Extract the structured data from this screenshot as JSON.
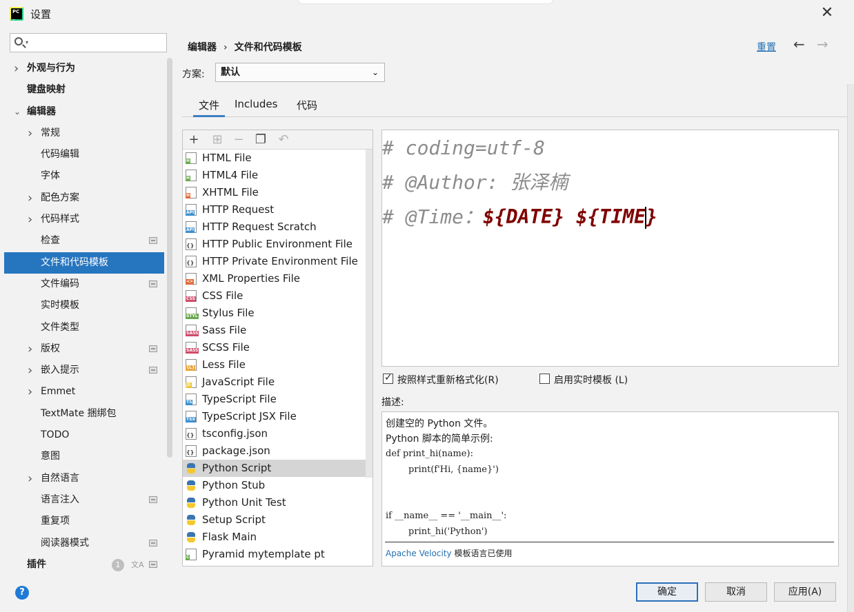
{
  "window": {
    "title": "设置"
  },
  "sidebar": {
    "search_placeholder": "",
    "items": [
      {
        "label": "外观与行为",
        "level": 0,
        "expand": "collapsed",
        "bold": true
      },
      {
        "label": "键盘映射",
        "level": 0,
        "expand": "none",
        "bold": true
      },
      {
        "label": "编辑器",
        "level": 0,
        "expand": "expanded",
        "bold": true
      },
      {
        "label": "常规",
        "level": 1,
        "expand": "collapsed"
      },
      {
        "label": "代码编辑",
        "level": 1,
        "expand": "none"
      },
      {
        "label": "字体",
        "level": 1,
        "expand": "none"
      },
      {
        "label": "配色方案",
        "level": 1,
        "expand": "collapsed"
      },
      {
        "label": "代码样式",
        "level": 1,
        "expand": "collapsed"
      },
      {
        "label": "检查",
        "level": 1,
        "expand": "none",
        "pin": true
      },
      {
        "label": "文件和代码模板",
        "level": 1,
        "expand": "none",
        "selected": true
      },
      {
        "label": "文件编码",
        "level": 1,
        "expand": "none",
        "pin": true
      },
      {
        "label": "实时模板",
        "level": 1,
        "expand": "none"
      },
      {
        "label": "文件类型",
        "level": 1,
        "expand": "none"
      },
      {
        "label": "版权",
        "level": 1,
        "expand": "collapsed",
        "pin": true
      },
      {
        "label": "嵌入提示",
        "level": 1,
        "expand": "collapsed",
        "pin": true
      },
      {
        "label": "Emmet",
        "level": 1,
        "expand": "collapsed"
      },
      {
        "label": "TextMate 捆绑包",
        "level": 1,
        "expand": "none"
      },
      {
        "label": "TODO",
        "level": 1,
        "expand": "none"
      },
      {
        "label": "意图",
        "level": 1,
        "expand": "none"
      },
      {
        "label": "自然语言",
        "level": 1,
        "expand": "collapsed"
      },
      {
        "label": "语言注入",
        "level": 1,
        "expand": "none",
        "pin": true
      },
      {
        "label": "重复项",
        "level": 1,
        "expand": "none"
      },
      {
        "label": "阅读器模式",
        "level": 1,
        "expand": "none",
        "pin": true
      },
      {
        "label": "插件",
        "level": 0,
        "expand": "none",
        "bold": true,
        "badge": "1",
        "translate": true,
        "pin": true
      }
    ]
  },
  "header": {
    "breadcrumb": [
      "编辑器",
      "文件和代码模板"
    ],
    "breadcrumb_sep": "›",
    "reset_label": "重置"
  },
  "scheme": {
    "label": "方案:",
    "value": "默认"
  },
  "tabs": [
    {
      "label": "文件",
      "active": true
    },
    {
      "label": "Includes",
      "active": false
    },
    {
      "label": "代码",
      "active": false
    }
  ],
  "templates": [
    {
      "name": "HTML File",
      "icon": "html",
      "tag": "H",
      "color": "#6aa84f"
    },
    {
      "name": "HTML4 File",
      "icon": "html",
      "tag": "H",
      "color": "#6aa84f"
    },
    {
      "name": "XHTML File",
      "icon": "xhtml",
      "tag": "H",
      "color": "#e06c3a"
    },
    {
      "name": "HTTP Request",
      "icon": "api",
      "tag": "API",
      "color": "#3b8fcf"
    },
    {
      "name": "HTTP Request Scratch",
      "icon": "api",
      "tag": "API",
      "color": "#3b8fcf"
    },
    {
      "name": "HTTP Public Environment File",
      "icon": "json",
      "tag": "{}",
      "color": "#666666"
    },
    {
      "name": "HTTP Private Environment File",
      "icon": "json",
      "tag": "{}",
      "color": "#666666"
    },
    {
      "name": "XML Properties File",
      "icon": "xml",
      "tag": "<>",
      "color": "#e06c3a"
    },
    {
      "name": "CSS File",
      "icon": "css",
      "tag": "CSS",
      "color": "#d04a6a"
    },
    {
      "name": "Stylus File",
      "icon": "stylus",
      "tag": "STYL",
      "color": "#6aa84f"
    },
    {
      "name": "Sass File",
      "icon": "sass",
      "tag": "SASS",
      "color": "#d04a6a"
    },
    {
      "name": "SCSS File",
      "icon": "scss",
      "tag": "SASS",
      "color": "#d04a6a"
    },
    {
      "name": "Less File",
      "icon": "less",
      "tag": "{L}",
      "color": "#e8a33a"
    },
    {
      "name": "JavaScript File",
      "icon": "js",
      "tag": "JS",
      "color": "#e8c43a"
    },
    {
      "name": "TypeScript File",
      "icon": "ts",
      "tag": "TS",
      "color": "#3b8fcf"
    },
    {
      "name": "TypeScript JSX File",
      "icon": "tsx",
      "tag": "TSX",
      "color": "#3b8fcf"
    },
    {
      "name": "tsconfig.json",
      "icon": "json",
      "tag": "{}",
      "color": "#666666"
    },
    {
      "name": "package.json",
      "icon": "json",
      "tag": "{}",
      "color": "#666666"
    },
    {
      "name": "Python Script",
      "icon": "python",
      "selected": true
    },
    {
      "name": "Python Stub",
      "icon": "python"
    },
    {
      "name": "Python Unit Test",
      "icon": "python"
    },
    {
      "name": "Setup Script",
      "icon": "python"
    },
    {
      "name": "Flask Main",
      "icon": "python"
    },
    {
      "name": "Pyramid mytemplate pt",
      "icon": "chameleon",
      "tag": "C",
      "color": "#6aa84f"
    }
  ],
  "editor": {
    "line1": "# coding=utf-8",
    "line2": "# @Author: 张泽楠",
    "line3_prefix": "# @Time：",
    "var_date": "${DATE}",
    "var_time": "${TIME}"
  },
  "options": {
    "reformat_label": "按照样式重新格式化(R)",
    "reformat_checked": true,
    "live_templates_label": "启用实时模板 (L)",
    "live_templates_checked": false
  },
  "description": {
    "label": "描述:",
    "line1": "创建空的 Python 文件。",
    "line2": "Python 脚本的简单示例:",
    "code": [
      "def print_hi(name):",
      "        print(f'Hi, {name}')",
      "",
      "",
      "if __name__ == '__main__':",
      "        print_hi('Python')"
    ],
    "footer_link": "Apache Velocity",
    "footer_text": " 模板语言已使用"
  },
  "buttons": {
    "ok": "确定",
    "cancel": "取消",
    "apply": "应用(A)",
    "help": "?"
  },
  "colors": {
    "accent": "#2675bf",
    "template_var": "#7f0000",
    "comment": "#8c8c8c"
  }
}
